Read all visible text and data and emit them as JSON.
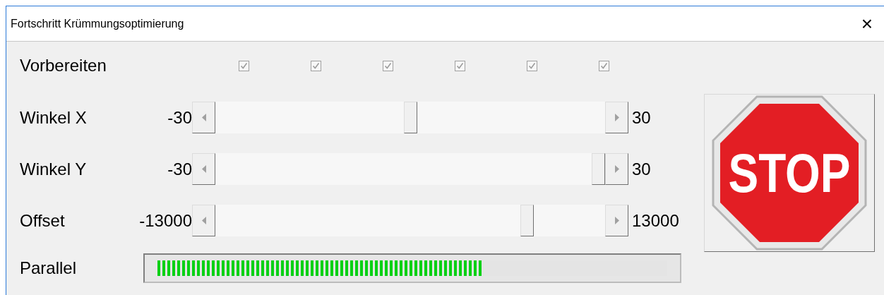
{
  "window": {
    "title": "Fortschritt Krümmungsoptimierung",
    "close": "×"
  },
  "prepare": {
    "label": "Vorbereiten",
    "checkboxes": [
      {
        "checked": true,
        "disabled": true
      },
      {
        "checked": true,
        "disabled": true
      },
      {
        "checked": true,
        "disabled": true
      },
      {
        "checked": true,
        "disabled": true
      },
      {
        "checked": true,
        "disabled": true
      },
      {
        "checked": true,
        "disabled": true
      }
    ]
  },
  "sliders": [
    {
      "label": "Winkel X",
      "min": "-30",
      "max": "30"
    },
    {
      "label": "Winkel Y",
      "min": "-30",
      "max": "30"
    },
    {
      "label": "Offset",
      "min": "-13000",
      "max": "13000"
    }
  ],
  "parallel": {
    "label": "Parallel",
    "level": 0.64
  },
  "stop_button": {
    "label": "STOP"
  }
}
